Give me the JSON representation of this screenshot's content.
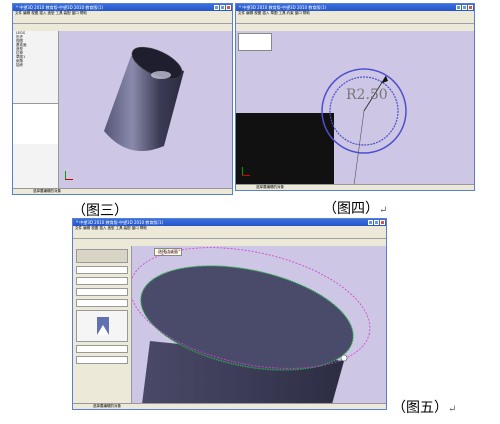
{
  "screens": {
    "s3": {
      "title": "* 中望3D  2010  教育版-中望3D  2010  教育版(1)",
      "menu": "文件  编辑  视图  插入  造型  工具  装配  窗口  帮助",
      "status": "选择要编辑的对象",
      "tree_items": [
        "LEGS",
        "历史",
        "视图",
        "基准面",
        "造型",
        "拉伸",
        "草图1",
        "倒角",
        "抽壳"
      ]
    },
    "s4": {
      "title": "* 中望3D  2010  教育版-中望3D  2010  教育版(1)",
      "menu": "文件  编辑  视图  插入  草图  工具  约束  窗口  帮助",
      "status": "选择要编辑的对象",
      "dimension_label": "R2.50"
    },
    "s5": {
      "title": "* 中望3D  2010  教育版-中望3D  2010  教育版(1)",
      "menu": "文件  编辑  视图  插入  造型  工具  装配  窗口  帮助",
      "status": "选择要编辑的对象",
      "tooltip": "选择边或面"
    }
  },
  "captions": {
    "fig3": "（图三）",
    "fig4": "（图四）",
    "fig5": "（图五）"
  },
  "return_mark": "↵",
  "colors": {
    "viewport_bg": "#cdc6e4",
    "titlebar": "#2556c8",
    "cylinder": "#3a3a5a"
  }
}
